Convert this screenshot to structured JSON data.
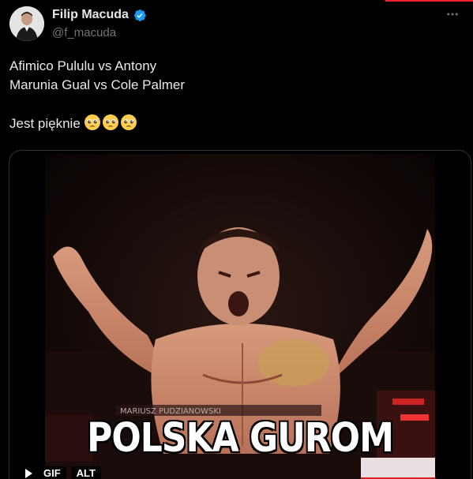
{
  "author": {
    "display_name": "Filip Macuda",
    "handle": "@f_macuda",
    "verified": true
  },
  "tweet": {
    "lines": [
      "Afimico Pululu vs Antony",
      "Marunia Gual vs Cole Palmer",
      "",
      "Jest pięknie"
    ],
    "emoji": [
      "pleading-face",
      "pleading-face",
      "pleading-face"
    ]
  },
  "media": {
    "caption": "POLSKA GUROM",
    "badges": {
      "gif": "GIF",
      "alt": "ALT"
    }
  },
  "colors": {
    "background": "#000000",
    "text": "#e7e9ea",
    "muted": "#71767b",
    "verified": "#1d9bf0",
    "accent_bar": "#f4212e"
  }
}
